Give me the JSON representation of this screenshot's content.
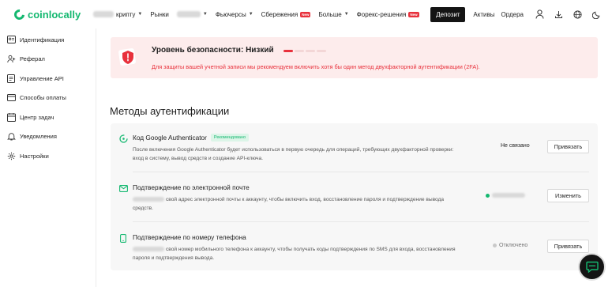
{
  "header": {
    "brand": "coinlocally",
    "nav": [
      {
        "label": "криптy",
        "caret": true,
        "blur_prefix": true
      },
      {
        "label": "Рынки"
      },
      {
        "label": "",
        "caret": true,
        "blur_only": true
      },
      {
        "label": "Фьючерсы",
        "caret": true
      },
      {
        "label": "Сбережения",
        "badge": "New"
      },
      {
        "label": "Больше",
        "caret": true
      },
      {
        "label": "Форекс-решения",
        "badge": "New"
      }
    ],
    "deposit_label": "Депозит",
    "assets_label": "Активы",
    "orders_label": "Ордера",
    "icons": [
      "user-icon",
      "download-icon",
      "globe-icon",
      "moon-icon"
    ]
  },
  "sidebar": {
    "items": [
      {
        "label": "Идентификация",
        "icon": "id-card-icon"
      },
      {
        "label": "Реферал",
        "icon": "referral-icon"
      },
      {
        "label": "Управление API",
        "icon": "api-icon"
      },
      {
        "label": "Способы оплаты",
        "icon": "card-icon"
      },
      {
        "label": "Центр задач",
        "icon": "tasks-icon"
      },
      {
        "label": "Уведомления",
        "icon": "bell-icon"
      },
      {
        "label": "Настройки",
        "icon": "gear-icon"
      }
    ]
  },
  "security_warning": {
    "title": "Уровень безопасности: Низкий",
    "level": 1,
    "level_max": 4,
    "text": "Для защиты вашей учетной записи мы рекомендуем включить хотя бы один метод двухфакторной аутентификации (2FA).",
    "accent": "#e8313c"
  },
  "methods": {
    "title": "Методы аутентификации",
    "items": [
      {
        "title": "Код Google Authenticator",
        "badge": "Рекомендовано",
        "desc": "После включения Google Authenticator будет использоваться в первую очередь для операций, требующих двухфакторной проверки: вход в систему, вывод средств и создание API-ключа.",
        "status": "Не связано",
        "button": "Привязать",
        "icon": "authenticator-icon"
      },
      {
        "title": "Подтверждение по электронной почте",
        "badge": "",
        "desc": "свой адрес электронной почты к аккаунту, чтобы включить вход, восстановление пароля и подтверждение вывода средств.",
        "status": "",
        "status_color": "#14b870",
        "button": "Изменить",
        "icon": "email-icon"
      },
      {
        "title": "Подтверждение по номеру телефона",
        "badge": "",
        "desc": "свой номер мобильного телефона к аккаунту, чтобы получать коды подтверждения по SMS для входа, восстановления пароля и подтверждения вывода.",
        "status": "Отключено",
        "status_color": "#c9c9c9",
        "button": "Привязать",
        "icon": "phone-icon"
      }
    ]
  },
  "colors": {
    "brand": "#14b870",
    "danger": "#e8313c",
    "dark": "#141414"
  }
}
